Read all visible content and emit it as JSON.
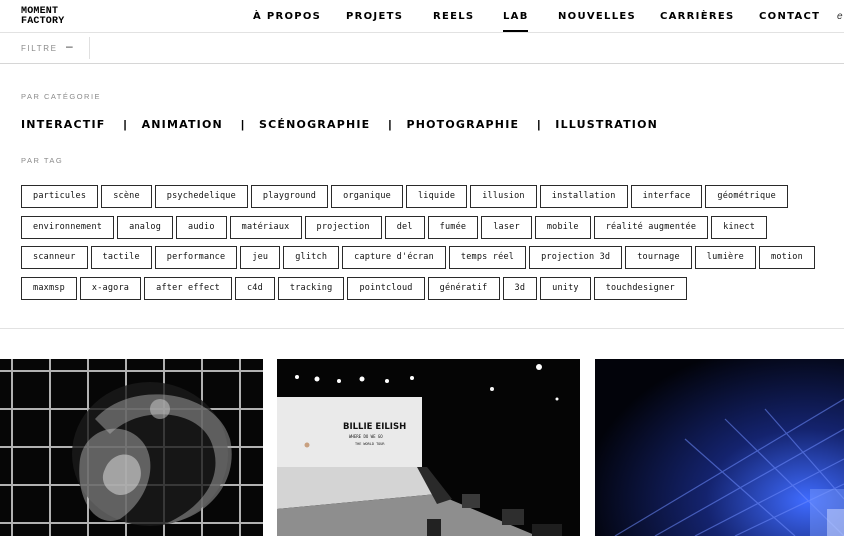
{
  "header": {
    "logo": [
      "MOMENT",
      "FACTORY"
    ],
    "nav": [
      {
        "label": "À PROPOS"
      },
      {
        "label": "PROJETS"
      },
      {
        "label": "REELS"
      },
      {
        "label": "LAB"
      },
      {
        "label": "NOUVELLES"
      },
      {
        "label": "CARRIÈRES"
      },
      {
        "label": "CONTACT"
      }
    ],
    "active_nav": "LAB",
    "lang": "e"
  },
  "filter_bar": {
    "label": "FILTRE",
    "toggle": "–"
  },
  "categories": {
    "label": "PAR CATÉGORIE",
    "items": [
      "INTERACTIF",
      "ANIMATION",
      "SCÉNOGRAPHIE",
      "PHOTOGRAPHIE",
      "ILLUSTRATION"
    ],
    "separator": "|"
  },
  "tags": {
    "label": "PAR TAG",
    "items": [
      "particules",
      "scène",
      "psychedelique",
      "playground",
      "organique",
      "liquide",
      "illusion",
      "installation",
      "interface",
      "géométrique",
      "environnement",
      "analog",
      "audio",
      "matériaux",
      "projection",
      "del",
      "fumée",
      "laser",
      "mobile",
      "réalité augmentée",
      "kinect",
      "scanneur",
      "tactile",
      "performance",
      "jeu",
      "glitch",
      "capture d'écran",
      "temps réel",
      "projection 3d",
      "tournage",
      "lumière",
      "motion",
      "maxmsp",
      "x-agora",
      "after effect",
      "c4d",
      "tracking",
      "pointcloud",
      "génératif",
      "3d",
      "unity",
      "touchdesigner"
    ]
  },
  "thumbnails": {
    "stage_title": "BILLIE EILISH",
    "stage_subtitle": "WHERE DO WE GO",
    "stage_caption": "THE WORLD TOUR"
  },
  "colors": {
    "text": "#111111",
    "muted": "#8a8a8a",
    "border": "#2a2a2a"
  }
}
